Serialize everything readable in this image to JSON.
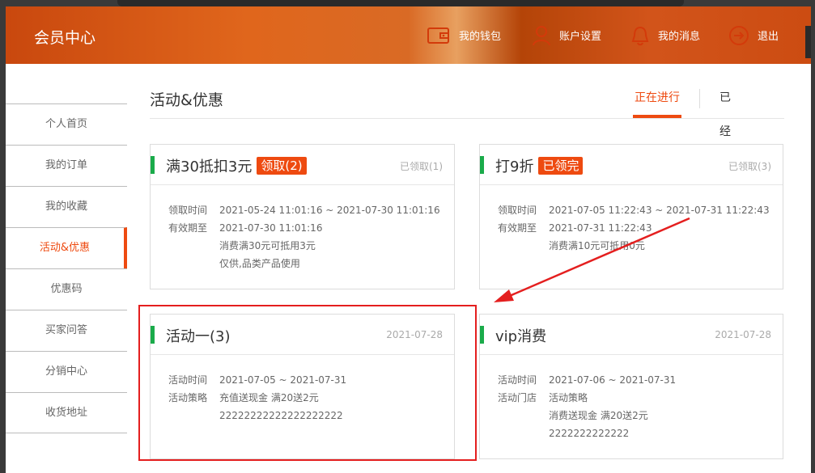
{
  "header": {
    "brand": "会员中心",
    "nav": {
      "wallet": "我的钱包",
      "account": "账户设置",
      "messages": "我的消息",
      "logout": "退出"
    }
  },
  "sidebar": {
    "items": [
      {
        "label": "个人首页"
      },
      {
        "label": "我的订单"
      },
      {
        "label": "我的收藏"
      },
      {
        "label": "活动&优惠"
      },
      {
        "label": "优惠码"
      },
      {
        "label": "买家问答"
      },
      {
        "label": "分销中心"
      },
      {
        "label": "收货地址"
      }
    ],
    "active_index": 3
  },
  "main": {
    "title": "活动&优惠",
    "tabs": {
      "active": "正在进行",
      "expired": "已经过期"
    }
  },
  "cards": [
    {
      "title": "满30抵扣3元",
      "badge": "领取(2)",
      "meta": "已领取(1)",
      "rows": [
        {
          "label": "领取时间",
          "value": "2021-05-24 11:01:16 ~ 2021-07-30 11:01:16"
        },
        {
          "label": "有效期至",
          "value": "2021-07-30 11:01:16"
        }
      ],
      "extra": [
        "消费满30元可抵用3元",
        "仅供,品类产品使用"
      ]
    },
    {
      "title": "打9折",
      "badge": "已领完",
      "meta": "已领取(3)",
      "rows": [
        {
          "label": "领取时间",
          "value": "2021-07-05 11:22:43 ~ 2021-07-31 11:22:43"
        },
        {
          "label": "有效期至",
          "value": "2021-07-31 11:22:43"
        }
      ],
      "extra": [
        "消费满10元可抵用0元"
      ]
    },
    {
      "title": "活动一(3)",
      "meta": "2021-07-28",
      "rows": [
        {
          "label": "活动时间",
          "value": "2021-07-05 ~ 2021-07-31"
        },
        {
          "label": "活动策略",
          "value": "充值送现金 满20送2元"
        }
      ],
      "extra": [
        "22222222222222222222"
      ]
    },
    {
      "title": "vip消费",
      "meta": "2021-07-28",
      "rows": [
        {
          "label": "活动时间",
          "value": "2021-07-06 ~ 2021-07-31"
        },
        {
          "label": "活动门店",
          "value": " 活动策略"
        }
      ],
      "extra": [
        "消费送现金 满20送2元",
        "2222222222222"
      ]
    }
  ],
  "colors": {
    "accent": "#ee4a10",
    "green_bar": "#1aab4a",
    "annotation_red": "#e41f1f"
  }
}
